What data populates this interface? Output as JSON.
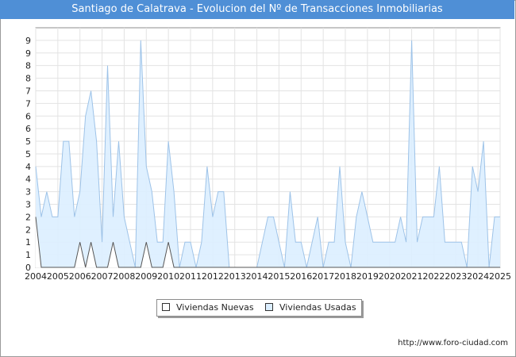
{
  "header": {
    "title": "Santiago de Calatrava - Evolucion del Nº de Transacciones Inmobiliarias"
  },
  "footer": {
    "source": "http://www.foro-ciudad.com"
  },
  "colors": {
    "title_bg": "#4f8fd6",
    "usadas_fill": "#dbeeff",
    "usadas_line": "#9ec3e8",
    "nuevas_fill": "#ffffff",
    "nuevas_line": "#555555"
  },
  "chart_data": {
    "type": "area",
    "title": "Santiago de Calatrava - Evolucion del Nº de Transacciones Inmobiliarias",
    "xlabel": "",
    "ylabel": "",
    "ylim": [
      0,
      9.5
    ],
    "y_ticks": [
      "0",
      "1",
      "1",
      "2",
      "2",
      "3",
      "3",
      "4",
      "4",
      "5",
      "5",
      "6",
      "6",
      "7",
      "7",
      "8",
      "8",
      "9",
      "9"
    ],
    "x_ticks": [
      "2004",
      "2005",
      "2006",
      "2007",
      "2008",
      "2009",
      "2010",
      "2011",
      "2012",
      "2013",
      "2014",
      "2015",
      "2016",
      "2017",
      "2018",
      "2019",
      "2020",
      "2021",
      "2022",
      "2023",
      "2024",
      "2025"
    ],
    "x_start": 2004,
    "x_end": 2025,
    "grid": true,
    "legend_position": "bottom",
    "series": [
      {
        "name": "Viviendas Nuevas",
        "x": [
          2004.0,
          2004.25,
          2004.5,
          2004.75,
          2005.0,
          2005.25,
          2005.5,
          2005.75,
          2006.0,
          2006.25,
          2006.5,
          2006.75,
          2007.0,
          2007.25,
          2007.5,
          2007.75,
          2008.0,
          2008.25,
          2008.5,
          2008.75,
          2009.0,
          2009.25,
          2009.5,
          2009.75,
          2010.0,
          2010.25,
          2010.5,
          2010.75,
          2011.0,
          2011.25,
          2011.5,
          2011.75,
          2012.0,
          2012.25,
          2012.5,
          2012.75,
          2013.0,
          2013.25,
          2013.5,
          2013.75,
          2014.0,
          2014.25,
          2014.5,
          2014.75,
          2015.0,
          2015.25,
          2015.5,
          2015.75,
          2016.0,
          2016.25,
          2016.5,
          2016.75,
          2017.0,
          2017.25,
          2017.5,
          2017.75,
          2018.0,
          2018.25,
          2018.5,
          2018.75,
          2019.0,
          2019.25,
          2019.5,
          2019.75,
          2020.0,
          2020.25,
          2020.5,
          2020.75,
          2021.0,
          2021.25,
          2021.5,
          2021.75,
          2022.0,
          2022.25,
          2022.5,
          2022.75,
          2023.0,
          2023.25,
          2023.5,
          2023.75,
          2024.0,
          2024.25,
          2024.5,
          2024.75,
          2025.0
        ],
        "values": [
          2,
          0,
          0,
          0,
          0,
          0,
          0,
          0,
          1,
          0,
          1,
          0,
          0,
          0,
          1,
          0,
          0,
          0,
          0,
          0,
          1,
          0,
          0,
          0,
          1,
          0,
          0,
          0,
          0,
          0,
          0,
          0,
          0,
          0,
          0,
          0,
          0,
          0,
          0,
          0,
          0,
          0,
          0,
          0,
          0,
          0,
          0,
          0,
          0,
          0,
          0,
          0,
          0,
          0,
          0,
          0,
          0,
          0,
          0,
          0,
          0,
          0,
          0,
          0,
          0,
          0,
          0,
          0,
          0,
          0,
          0,
          0,
          0,
          0,
          0,
          0,
          0,
          0,
          0,
          0,
          0,
          0,
          0,
          0,
          0
        ]
      },
      {
        "name": "Viviendas Usadas",
        "x": [
          2004.0,
          2004.25,
          2004.5,
          2004.75,
          2005.0,
          2005.25,
          2005.5,
          2005.75,
          2006.0,
          2006.25,
          2006.5,
          2006.75,
          2007.0,
          2007.25,
          2007.5,
          2007.75,
          2008.0,
          2008.25,
          2008.5,
          2008.75,
          2009.0,
          2009.25,
          2009.5,
          2009.75,
          2010.0,
          2010.25,
          2010.5,
          2010.75,
          2011.0,
          2011.25,
          2011.5,
          2011.75,
          2012.0,
          2012.25,
          2012.5,
          2012.75,
          2013.0,
          2013.25,
          2013.5,
          2013.75,
          2014.0,
          2014.25,
          2014.5,
          2014.75,
          2015.0,
          2015.25,
          2015.5,
          2015.75,
          2016.0,
          2016.25,
          2016.5,
          2016.75,
          2017.0,
          2017.25,
          2017.5,
          2017.75,
          2018.0,
          2018.25,
          2018.5,
          2018.75,
          2019.0,
          2019.25,
          2019.5,
          2019.75,
          2020.0,
          2020.25,
          2020.5,
          2020.75,
          2021.0,
          2021.25,
          2021.5,
          2021.75,
          2022.0,
          2022.25,
          2022.5,
          2022.75,
          2023.0,
          2023.25,
          2023.5,
          2023.75,
          2024.0,
          2024.25,
          2024.5,
          2024.75,
          2025.0
        ],
        "values": [
          4,
          2,
          3,
          2,
          2,
          5,
          5,
          2,
          3,
          6,
          7,
          5,
          1,
          8,
          2,
          5,
          2,
          1,
          0,
          9,
          4,
          3,
          1,
          1,
          5,
          3,
          0,
          1,
          1,
          0,
          1,
          4,
          2,
          3,
          3,
          0,
          0,
          0,
          0,
          0,
          0,
          1,
          2,
          2,
          1,
          0,
          3,
          1,
          1,
          0,
          1,
          2,
          0,
          1,
          1,
          4,
          1,
          0,
          2,
          3,
          2,
          1,
          1,
          1,
          1,
          1,
          2,
          1,
          9,
          1,
          2,
          2,
          2,
          4,
          1,
          1,
          1,
          1,
          0,
          4,
          3,
          5,
          0,
          2,
          2
        ]
      }
    ]
  }
}
